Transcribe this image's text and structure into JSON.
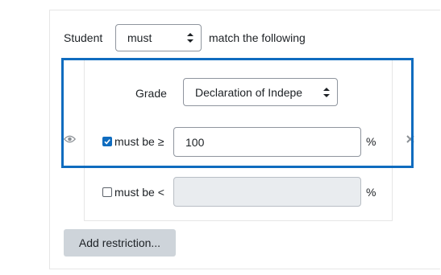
{
  "condition": {
    "prefix_label": "Student",
    "mode_select": {
      "selected": "must"
    },
    "suffix_label": "match the following"
  },
  "grade_restriction": {
    "grade_label": "Grade",
    "grade_select": {
      "selected": "Declaration of Indepe"
    },
    "min_checkbox": {
      "checked": true,
      "label": "must be ≥"
    },
    "min_value": "100",
    "min_unit": "%",
    "max_checkbox": {
      "checked": false,
      "label": "must be <"
    },
    "max_value": "",
    "max_unit": "%"
  },
  "icons": {
    "visibility": "eye-icon",
    "delete": "close-icon"
  },
  "buttons": {
    "add_restriction": "Add restriction..."
  },
  "colors": {
    "highlight_border": "#0f6cbf",
    "checkbox_checked": "#0f6cbf",
    "button_bg": "#ced4da"
  }
}
